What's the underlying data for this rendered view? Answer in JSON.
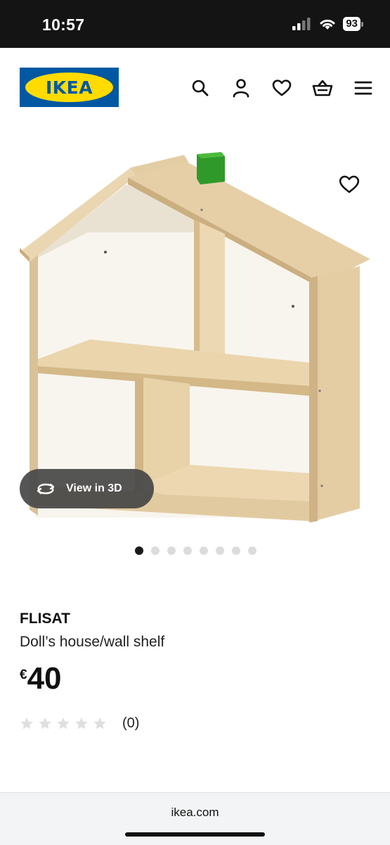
{
  "status_bar": {
    "time": "10:57",
    "battery": "93"
  },
  "header": {
    "logo_text": "IKEA",
    "icons": [
      "search-icon",
      "user-icon",
      "heart-icon",
      "basket-icon",
      "menu-icon"
    ]
  },
  "product_image": {
    "alt": "FLISAT doll's house/wall shelf",
    "view_3d_label": "View in 3D",
    "carousel": {
      "total": 8,
      "active": 0
    }
  },
  "product": {
    "name": "FLISAT",
    "description": "Doll’s house/wall shelf",
    "currency": "€",
    "price": "40",
    "rating_stars": 0,
    "rating_count": "(0)"
  },
  "browser": {
    "url": "ikea.com"
  },
  "colors": {
    "ikea_blue": "#0058a3",
    "ikea_yellow": "#ffdb00",
    "status_bar_bg": "#141414"
  }
}
